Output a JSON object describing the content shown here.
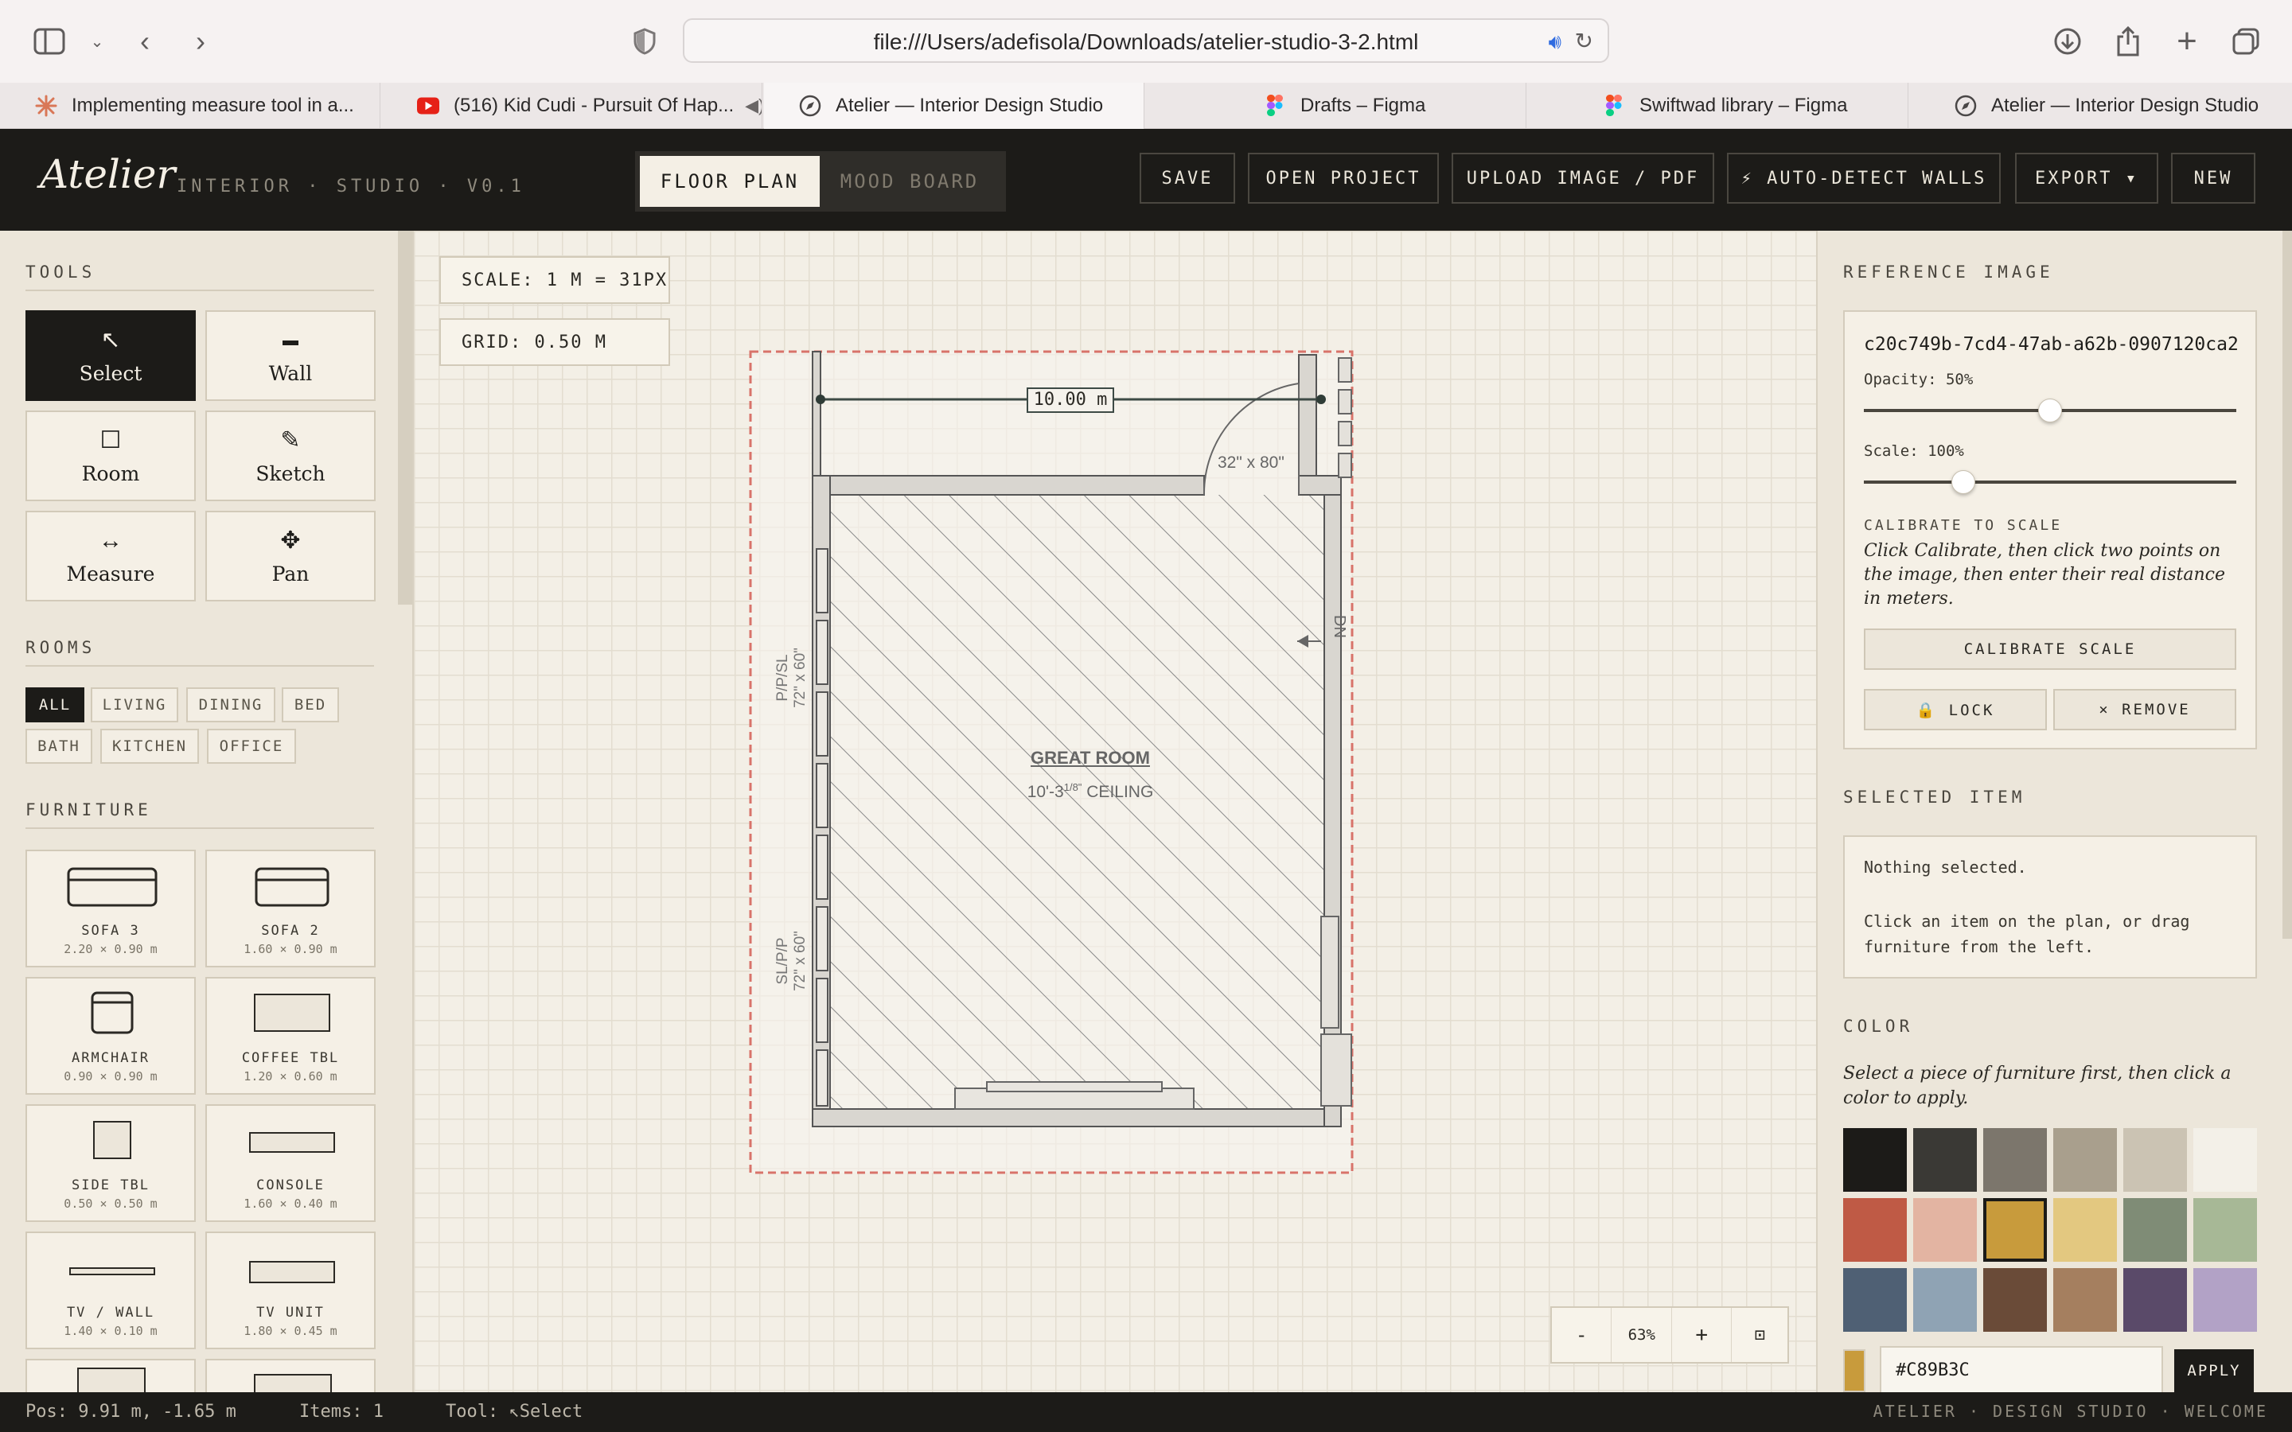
{
  "browser": {
    "url": "file:///Users/adefisola/Downloads/atelier-studio-3-2.html",
    "tabs": [
      {
        "title": "Implementing measure tool in a...",
        "icon": "claude-icon"
      },
      {
        "title": "(516) Kid Cudi - Pursuit Of Hap...",
        "icon": "youtube-icon"
      },
      {
        "title": "Atelier — Interior Design Studio",
        "icon": "compass-icon",
        "active": true
      },
      {
        "title": "Drafts – Figma",
        "icon": "figma-icon"
      },
      {
        "title": "Swiftwad library – Figma",
        "icon": "figma-icon"
      },
      {
        "title": "Atelier — Interior Design Studio",
        "icon": "compass-icon"
      }
    ]
  },
  "header": {
    "brand": "Atelier",
    "subtitle": "INTERIOR · STUDIO · V0.1",
    "views": [
      "FLOOR PLAN",
      "MOOD BOARD"
    ],
    "active_view": "FLOOR PLAN",
    "actions": [
      "SAVE",
      "OPEN PROJECT",
      "UPLOAD IMAGE / PDF",
      "⚡ AUTO-DETECT WALLS",
      "EXPORT ▾",
      "NEW"
    ]
  },
  "tools": {
    "title": "TOOLS",
    "items": [
      {
        "label": "Select",
        "icon": "↖",
        "active": true
      },
      {
        "label": "Wall",
        "icon": "▬"
      },
      {
        "label": "Room",
        "icon": "☐"
      },
      {
        "label": "Sketch",
        "icon": "✎"
      },
      {
        "label": "Measure",
        "icon": "↔"
      },
      {
        "label": "Pan",
        "icon": "✥"
      }
    ]
  },
  "rooms": {
    "title": "ROOMS",
    "chips": [
      "ALL",
      "LIVING",
      "DINING",
      "BED",
      "BATH",
      "KITCHEN",
      "OFFICE"
    ],
    "active": "ALL"
  },
  "furniture": {
    "title": "FURNITURE",
    "items": [
      {
        "name": "SOFA 3",
        "dims": "2.20 × 0.90 m",
        "icon": "sofa-icon"
      },
      {
        "name": "SOFA 2",
        "dims": "1.60 × 0.90 m",
        "icon": "sofa-icon"
      },
      {
        "name": "ARMCHAIR",
        "dims": "0.90 × 0.90 m",
        "icon": "armchair-icon"
      },
      {
        "name": "COFFEE TBL",
        "dims": "1.20 × 0.60 m",
        "icon": "table-icon"
      },
      {
        "name": "SIDE TBL",
        "dims": "0.50 × 0.50 m",
        "icon": "table-icon"
      },
      {
        "name": "CONSOLE",
        "dims": "1.60 × 0.40 m",
        "icon": "table-icon"
      },
      {
        "name": "TV / WALL",
        "dims": "1.40 × 0.10 m",
        "icon": "tv-icon"
      },
      {
        "name": "TV UNIT",
        "dims": "1.80 × 0.45 m",
        "icon": "tv-unit-icon"
      }
    ]
  },
  "canvas": {
    "scale": "SCALE: 1 M = 31PX",
    "grid": "GRID: 0.50 M",
    "measure_label": "10.00 m",
    "door_label": "32\" x 80\"",
    "room_name": "GREAT ROOM",
    "ceiling": "10'-3",
    "ceiling_sup": "1/8\"",
    "ceiling_suffix": "CEILING",
    "window_1_a": "P/P/SL",
    "window_1_b": "72\" x 60\"",
    "window_2_a": "SL/P/P",
    "window_2_b": "72\" x 60\"",
    "stair": "DN",
    "zoom": {
      "minus": "-",
      "level": "63%",
      "plus": "+",
      "fit": "⊡"
    }
  },
  "reference_image": {
    "title": "REFERENCE IMAGE",
    "filename": "c20c749b-7cd4-47ab-a62b-0907120ca2...",
    "opacity_label": "Opacity: 50%",
    "opacity_value": 0.5,
    "scale_label": "Scale: 100%",
    "scale_fraction": 0.25,
    "calibrate_title": "CALIBRATE TO SCALE",
    "calibrate_help": "Click Calibrate, then click two points on the image, then enter their real distance in meters.",
    "calibrate_button": "CALIBRATE SCALE",
    "lock_button": "🔒 LOCK",
    "remove_button": "× REMOVE"
  },
  "selected_item": {
    "title": "SELECTED ITEM",
    "line1": "Nothing selected.",
    "line2": "Click an item on the plan, or drag furniture from the left."
  },
  "color": {
    "title": "COLOR",
    "help": "Select a piece of furniture first, then click a color to apply.",
    "swatches": [
      "#1c1b18",
      "#3a3935",
      "#7c766c",
      "#a99f8d",
      "#cbc3b3",
      "#f3f0e8",
      "#bf5a45",
      "#e3b4a2",
      "#c89b3c",
      "#e3c880",
      "#7f8c76",
      "#a7b896",
      "#4f6074",
      "#8fa3b4",
      "#6a4b38",
      "#a57f5f",
      "#5a4a69",
      "#b2a2c6"
    ],
    "selected": "#C89B3C",
    "hex_value": "#C89B3C",
    "apply": "APPLY"
  },
  "status": {
    "pos": "Pos: 9.91 m, -1.65 m",
    "items": "Items: 1",
    "tool": "Tool: ↖Select",
    "right": "ATELIER · DESIGN STUDIO · WELCOME"
  }
}
